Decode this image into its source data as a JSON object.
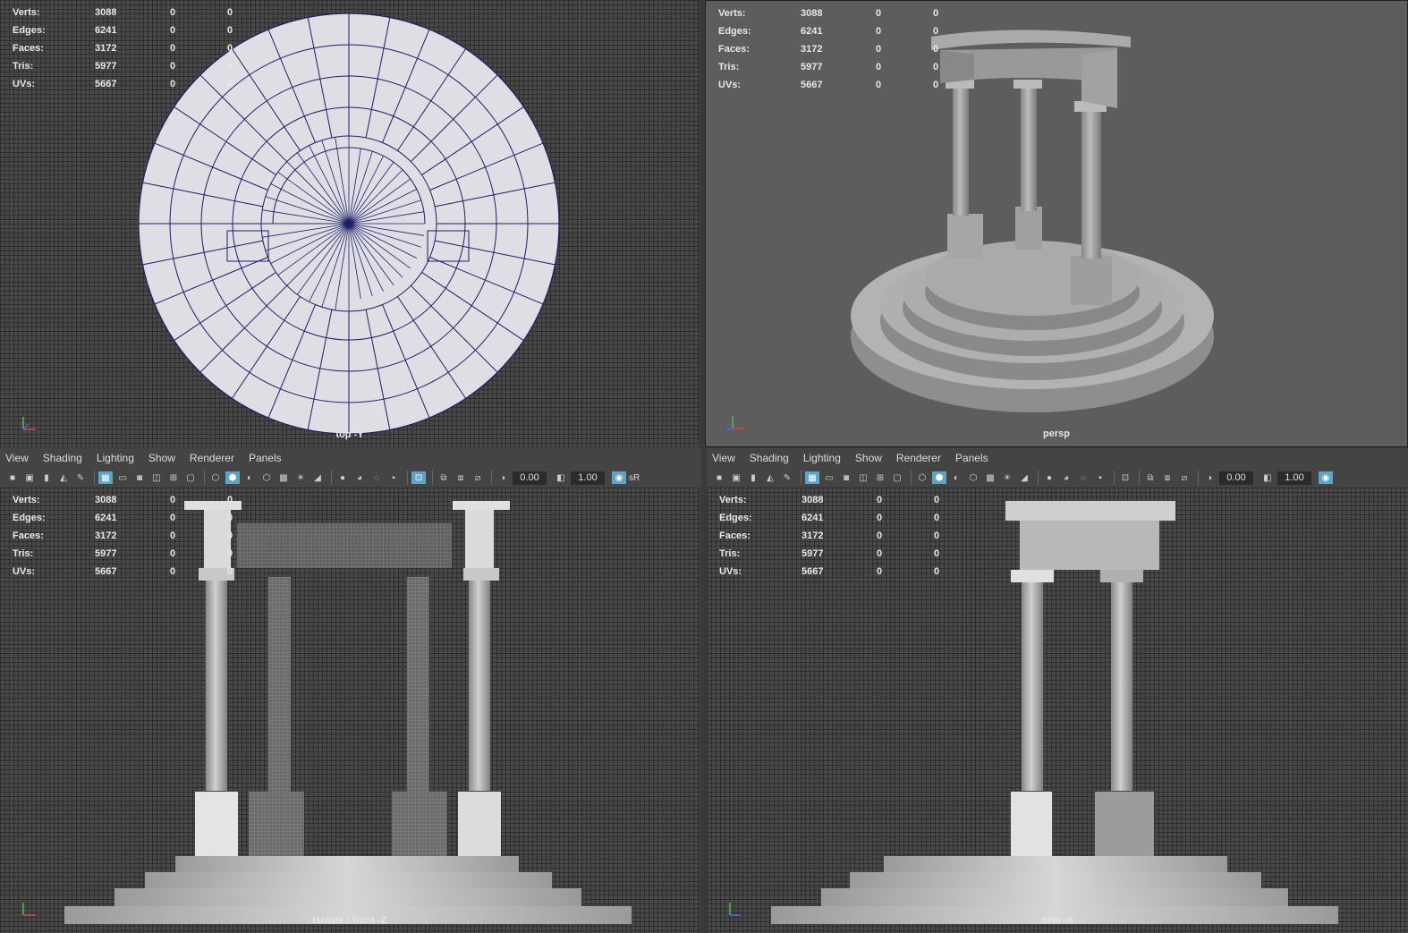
{
  "stats": {
    "rows": [
      {
        "label": "Verts:",
        "v1": "3088",
        "v2": "0",
        "v3": "0"
      },
      {
        "label": "Edges:",
        "v1": "6241",
        "v2": "0",
        "v3": "0"
      },
      {
        "label": "Faces:",
        "v1": "3172",
        "v2": "0",
        "v3": "0"
      },
      {
        "label": "Tris:",
        "v1": "5977",
        "v2": "0",
        "v3": "0"
      },
      {
        "label": "UVs:",
        "v1": "5667",
        "v2": "0",
        "v3": "0"
      }
    ]
  },
  "viewports": {
    "top": {
      "camera": "top -Y"
    },
    "persp": {
      "camera": "persp"
    },
    "front": {
      "camera": "Isolate : front -Z"
    },
    "side": {
      "camera": "side -X"
    }
  },
  "panel_menu": {
    "view": "View",
    "shading": "Shading",
    "lighting": "Lighting",
    "show": "Show",
    "renderer": "Renderer",
    "panels": "Panels"
  },
  "toolbar": {
    "field_a": "0.00",
    "field_b": "1.00",
    "gamma": "sR"
  },
  "axis": {
    "y": "y",
    "x": "x",
    "z": "z"
  },
  "colors": {
    "wire": "#1c1f66",
    "mesh": "#dedee4",
    "active": "#5fa4c4"
  }
}
